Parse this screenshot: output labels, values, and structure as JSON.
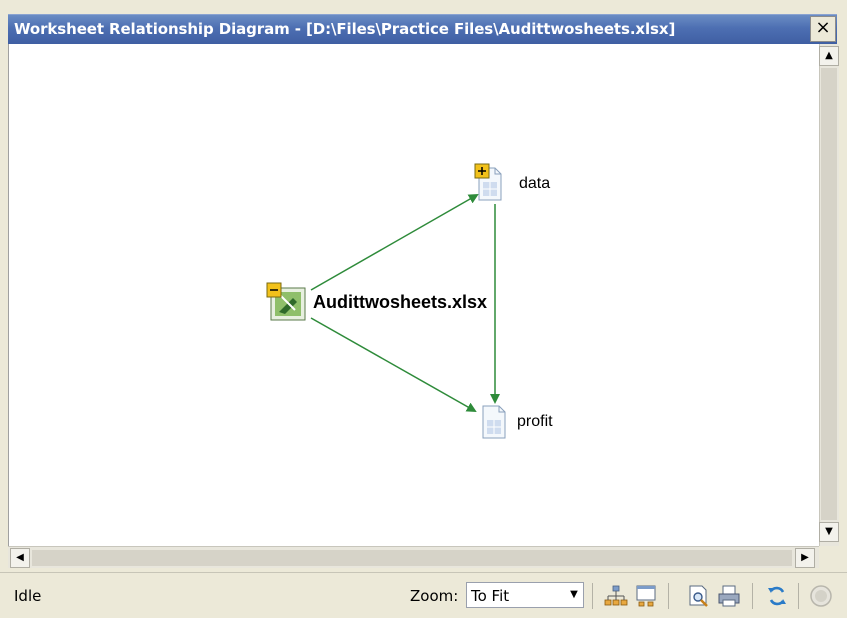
{
  "window": {
    "title": "Worksheet Relationship Diagram - [D:\\Files\\Practice Files\\Audittwosheets.xlsx]",
    "close_label": "×"
  },
  "diagram": {
    "root": {
      "label": "Audittwosheets.xlsx",
      "expander": "−"
    },
    "nodes": [
      {
        "label": "data",
        "expander": "+"
      },
      {
        "label": "profit"
      }
    ],
    "edges": [
      {
        "from": "Audittwosheets.xlsx",
        "to": "data"
      },
      {
        "from": "Audittwosheets.xlsx",
        "to": "profit"
      },
      {
        "from": "data",
        "to": "profit"
      }
    ],
    "edge_color": "#2e8b3a"
  },
  "scrollbars": {
    "up": "▲",
    "down": "▼",
    "left": "◀",
    "right": "▶"
  },
  "statusbar": {
    "status": "Idle",
    "zoom_label": "Zoom:",
    "zoom_value": "To Fit",
    "zoom_arrow": "▼",
    "tools": [
      "tree-layout-icon",
      "graph-layout-icon",
      "print-preview-icon",
      "print-icon",
      "refresh-icon",
      "stop-icon"
    ]
  }
}
